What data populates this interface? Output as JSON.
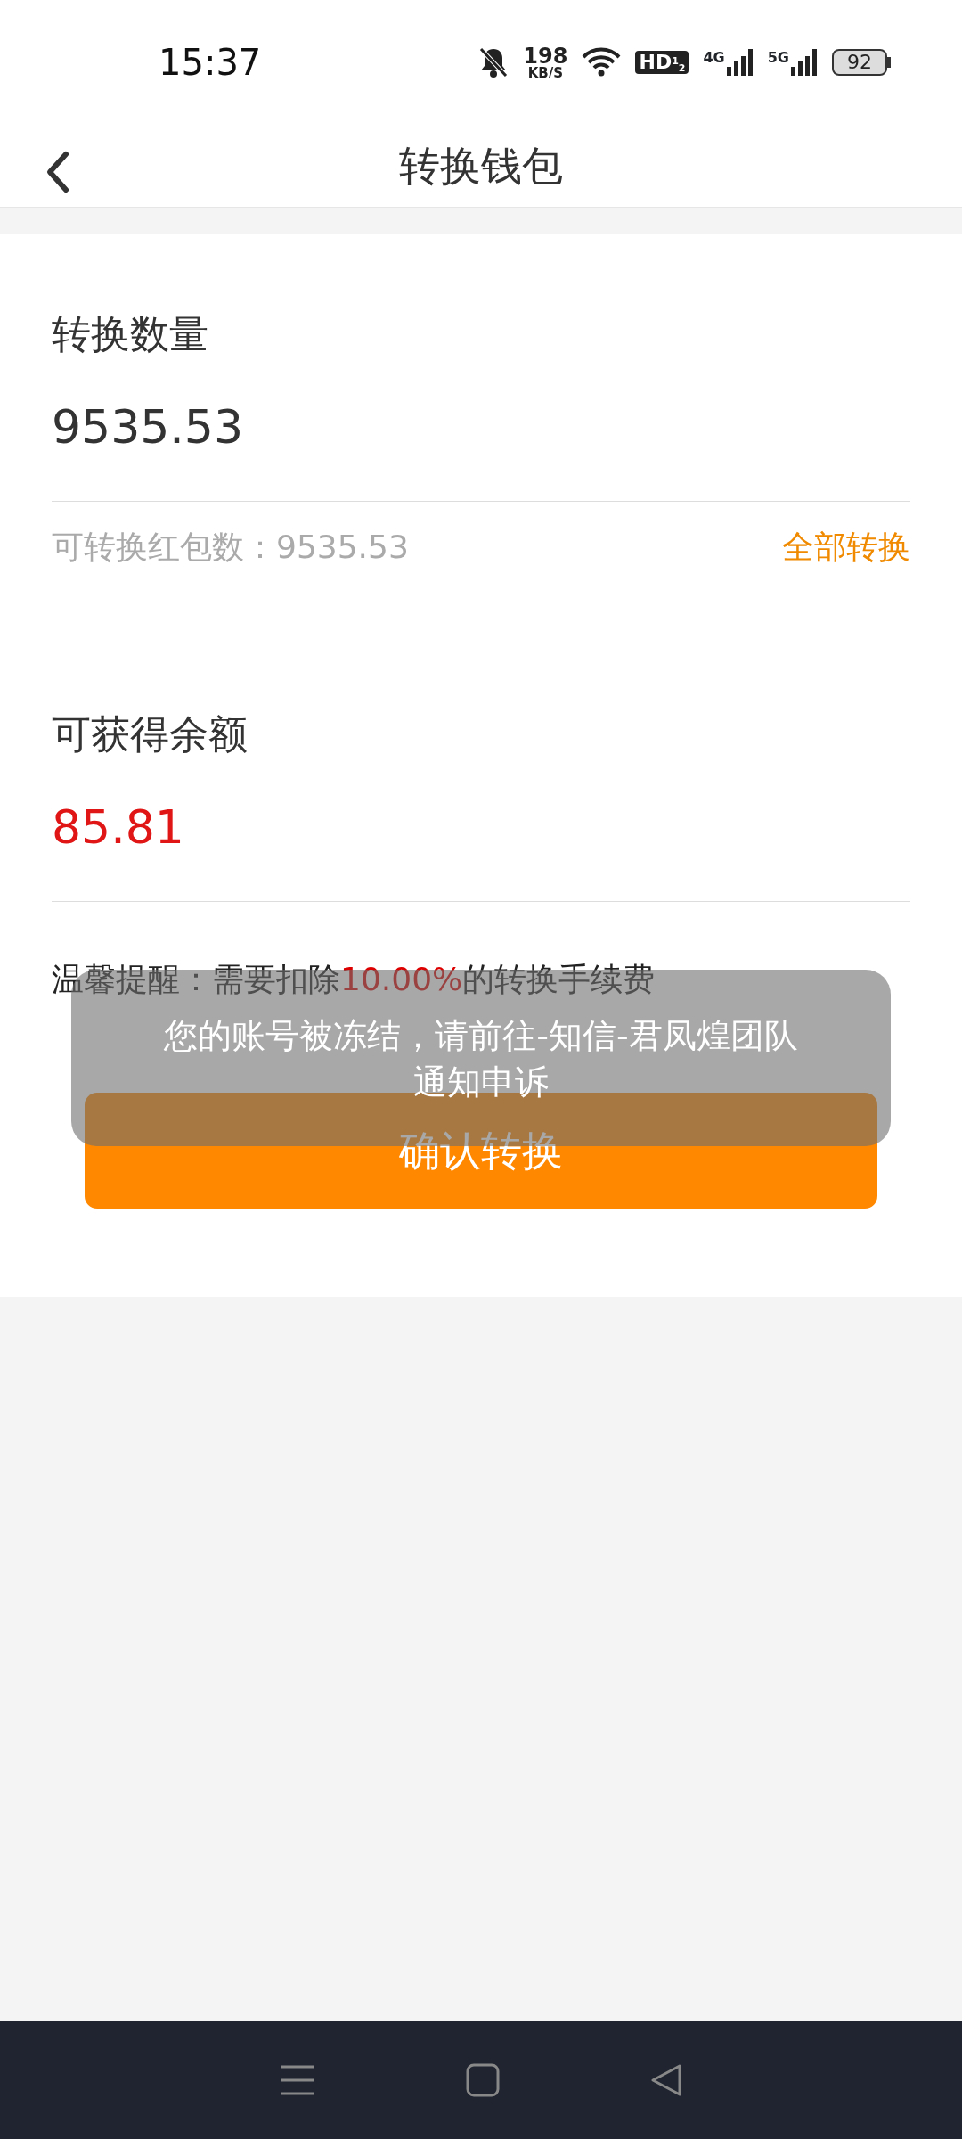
{
  "status_bar": {
    "time": "15:37",
    "speed_value": "198",
    "speed_unit": "KB/S",
    "hd": "HD$^{1}$$_{2}$",
    "signals": [
      {
        "label": "4G"
      },
      {
        "label": "5G"
      }
    ],
    "battery": "92"
  },
  "header": {
    "title": "转换钱包"
  },
  "convert": {
    "label": "转换数量",
    "value": "9535.53",
    "available": "可转换红包数：9535.53",
    "all_link": "全部转换"
  },
  "receive": {
    "label": "可获得余额",
    "value": "85.81"
  },
  "reminder": "温馨提醒：需要扣除**10.00%**的转换手续费",
  "confirm_button": "确认转换",
  "toast": {
    "lines": [
      "您的账号被冻结，请前往-知信-君凤煌团队",
      "通知申诉"
    ]
  }
}
